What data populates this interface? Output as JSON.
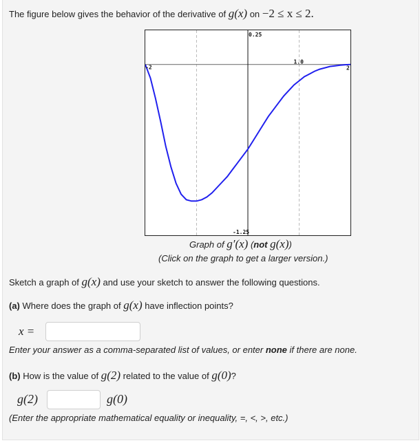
{
  "intro": {
    "text_before": "The figure below gives the behavior of the derivative of",
    "func": "g(x)",
    "text_mid": "on",
    "range": "−2 ≤ x ≤ 2."
  },
  "graph": {
    "caption_prefix": "Graph of",
    "caption_func": "g′(x)",
    "caption_not": "not",
    "caption_not_func": "g(x)",
    "caption_click": "(Click on the graph to get a larger version.)"
  },
  "chart_data": {
    "type": "line",
    "title": "Graph of g′(x) (not g(x))",
    "xlabel": "",
    "ylabel": "",
    "xlim": [
      -2,
      2
    ],
    "ylim": [
      -1.25,
      0.25
    ],
    "grid": true,
    "grid_x": [
      -1,
      1
    ],
    "tick_labels": {
      "x_min": "-2",
      "x_max": "2",
      "x_mark": "1.0",
      "y_max": "0.25",
      "y_min": "-1.25"
    },
    "series": [
      {
        "name": "g'(x)",
        "color": "#2020ee",
        "x": [
          -2,
          -1.9,
          -1.8,
          -1.7,
          -1.6,
          -1.5,
          -1.4,
          -1.3,
          -1.2,
          -1.1,
          -1.0,
          -0.9,
          -0.8,
          -0.7,
          -0.6,
          -0.5,
          -0.4,
          -0.3,
          -0.2,
          -0.1,
          0.0,
          0.1,
          0.2,
          0.3,
          0.4,
          0.5,
          0.6,
          0.7,
          0.8,
          0.9,
          1.0,
          1.1,
          1.2,
          1.3,
          1.4,
          1.5,
          1.6,
          1.7,
          1.8,
          1.9,
          2.0
        ],
        "y": [
          0.0,
          -0.1,
          -0.25,
          -0.42,
          -0.6,
          -0.75,
          -0.87,
          -0.95,
          -0.99,
          -1.0,
          -1.0,
          -0.99,
          -0.97,
          -0.94,
          -0.9,
          -0.86,
          -0.82,
          -0.77,
          -0.72,
          -0.67,
          -0.62,
          -0.56,
          -0.5,
          -0.44,
          -0.38,
          -0.33,
          -0.28,
          -0.23,
          -0.19,
          -0.15,
          -0.12,
          -0.09,
          -0.07,
          -0.05,
          -0.035,
          -0.025,
          -0.015,
          -0.01,
          -0.005,
          -0.002,
          0.0
        ]
      }
    ]
  },
  "prompt": {
    "text_before": "Sketch a graph of",
    "func": "g(x)",
    "text_after": "and use your sketch to answer the following questions."
  },
  "part_a": {
    "label": "(a)",
    "text_before": "Where does the graph of",
    "func": "g(x)",
    "text_after": "have inflection points?",
    "input_prefix": "x =",
    "input_value": "",
    "hint_before": "Enter your answer as a comma-separated list of values, or enter",
    "hint_bold": "none",
    "hint_after": "if there are none."
  },
  "part_b": {
    "label": "(b)",
    "text_before": "How is the value of",
    "func1": "g(2)",
    "text_mid": "related to the value of",
    "func2": "g(0)",
    "text_after": "?",
    "left_expr": "g(2)",
    "right_expr": "g(0)",
    "input_value": "",
    "hint": "(Enter the appropriate mathematical equality or inequality, =, <, >, etc.)"
  }
}
